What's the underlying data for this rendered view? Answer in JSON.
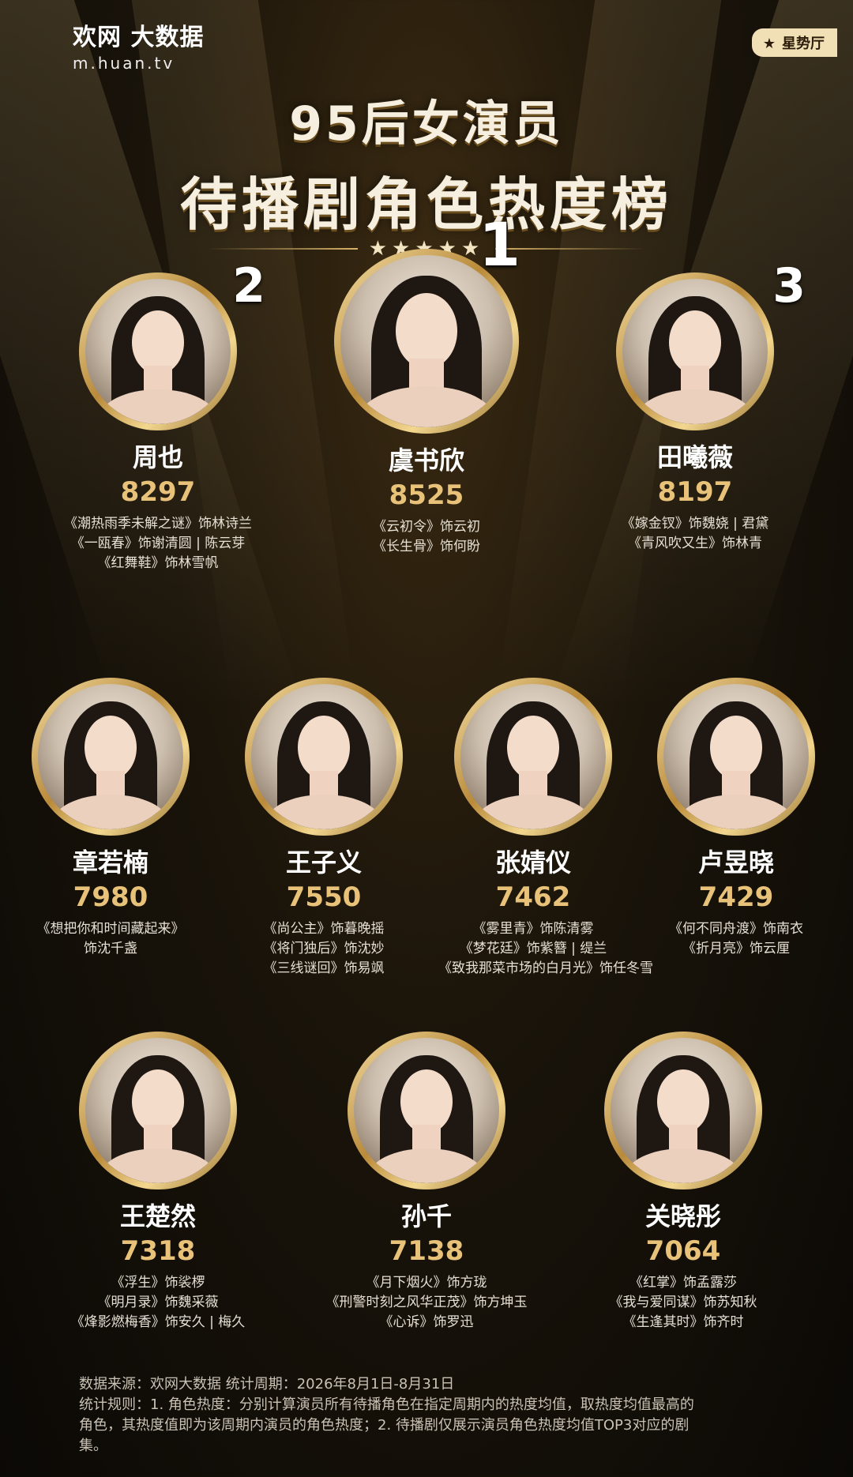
{
  "logo": {
    "main": "欢网 大数据",
    "url": "m.huan.tv"
  },
  "tag": "星势厅",
  "title": {
    "line1": "95后女演员",
    "line2": "待播剧角色热度榜",
    "stars": "★★★★★"
  },
  "top3": [
    {
      "rank": "2",
      "name": "周也",
      "score": "8297",
      "roles": [
        "《潮热雨季未解之谜》饰林诗兰",
        "《一瓯春》饰谢清圆 | 陈云芽",
        "《红舞鞋》饰林雪帆"
      ]
    },
    {
      "rank": "1",
      "name": "虞书欣",
      "score": "8525",
      "roles": [
        "《云初令》饰云初",
        "《长生骨》饰何盼"
      ]
    },
    {
      "rank": "3",
      "name": "田曦薇",
      "score": "8197",
      "roles": [
        "《嫁金钗》饰魏娆 | 君黛",
        "《青风吹又生》饰林青"
      ]
    }
  ],
  "row2": [
    {
      "name": "章若楠",
      "score": "7980",
      "roles": [
        "《想把你和时间藏起来》",
        "饰沈千盏"
      ]
    },
    {
      "name": "王子义",
      "score": "7550",
      "roles": [
        "《尚公主》饰暮晚摇",
        "《将门独后》饰沈妙",
        "《三线谜回》饰易飒"
      ]
    },
    {
      "name": "张婧仪",
      "score": "7462",
      "roles": [
        "《雾里青》饰陈清雾",
        "《梦花廷》饰紫簪 | 缇兰",
        "《致我那菜市场的白月光》饰任冬雪"
      ]
    },
    {
      "name": "卢昱晓",
      "score": "7429",
      "roles": [
        "《何不同舟渡》饰南衣",
        "《折月亮》饰云厘"
      ]
    }
  ],
  "row3": [
    {
      "name": "王楚然",
      "score": "7318",
      "roles": [
        "《浮生》饰裟椤",
        "《明月录》饰魏采薇",
        "《烽影燃梅香》饰安久 | 梅久"
      ]
    },
    {
      "name": "孙千",
      "score": "7138",
      "roles": [
        "《月下烟火》饰方珑",
        "《刑警时刻之风华正茂》饰方坤玉",
        "《心诉》饰罗迅"
      ]
    },
    {
      "name": "关晓彤",
      "score": "7064",
      "roles": [
        "《红掌》饰孟露莎",
        "《我与爱同谋》饰苏知秋",
        "《生逢其时》饰齐时"
      ]
    }
  ],
  "footer": {
    "source": "数据来源：欢网大数据    统计周期：2026年8月1日-8月31日",
    "rules1": "统计规则：1. 角色热度：分别计算演员所有待播角色在指定周期内的热度均值，取热度均值最高的",
    "rules2": "角色，其热度值即为该周期内演员的角色热度；2. 待播剧仅展示演员角色热度均值TOP3对应的剧",
    "rules3": "集。"
  }
}
